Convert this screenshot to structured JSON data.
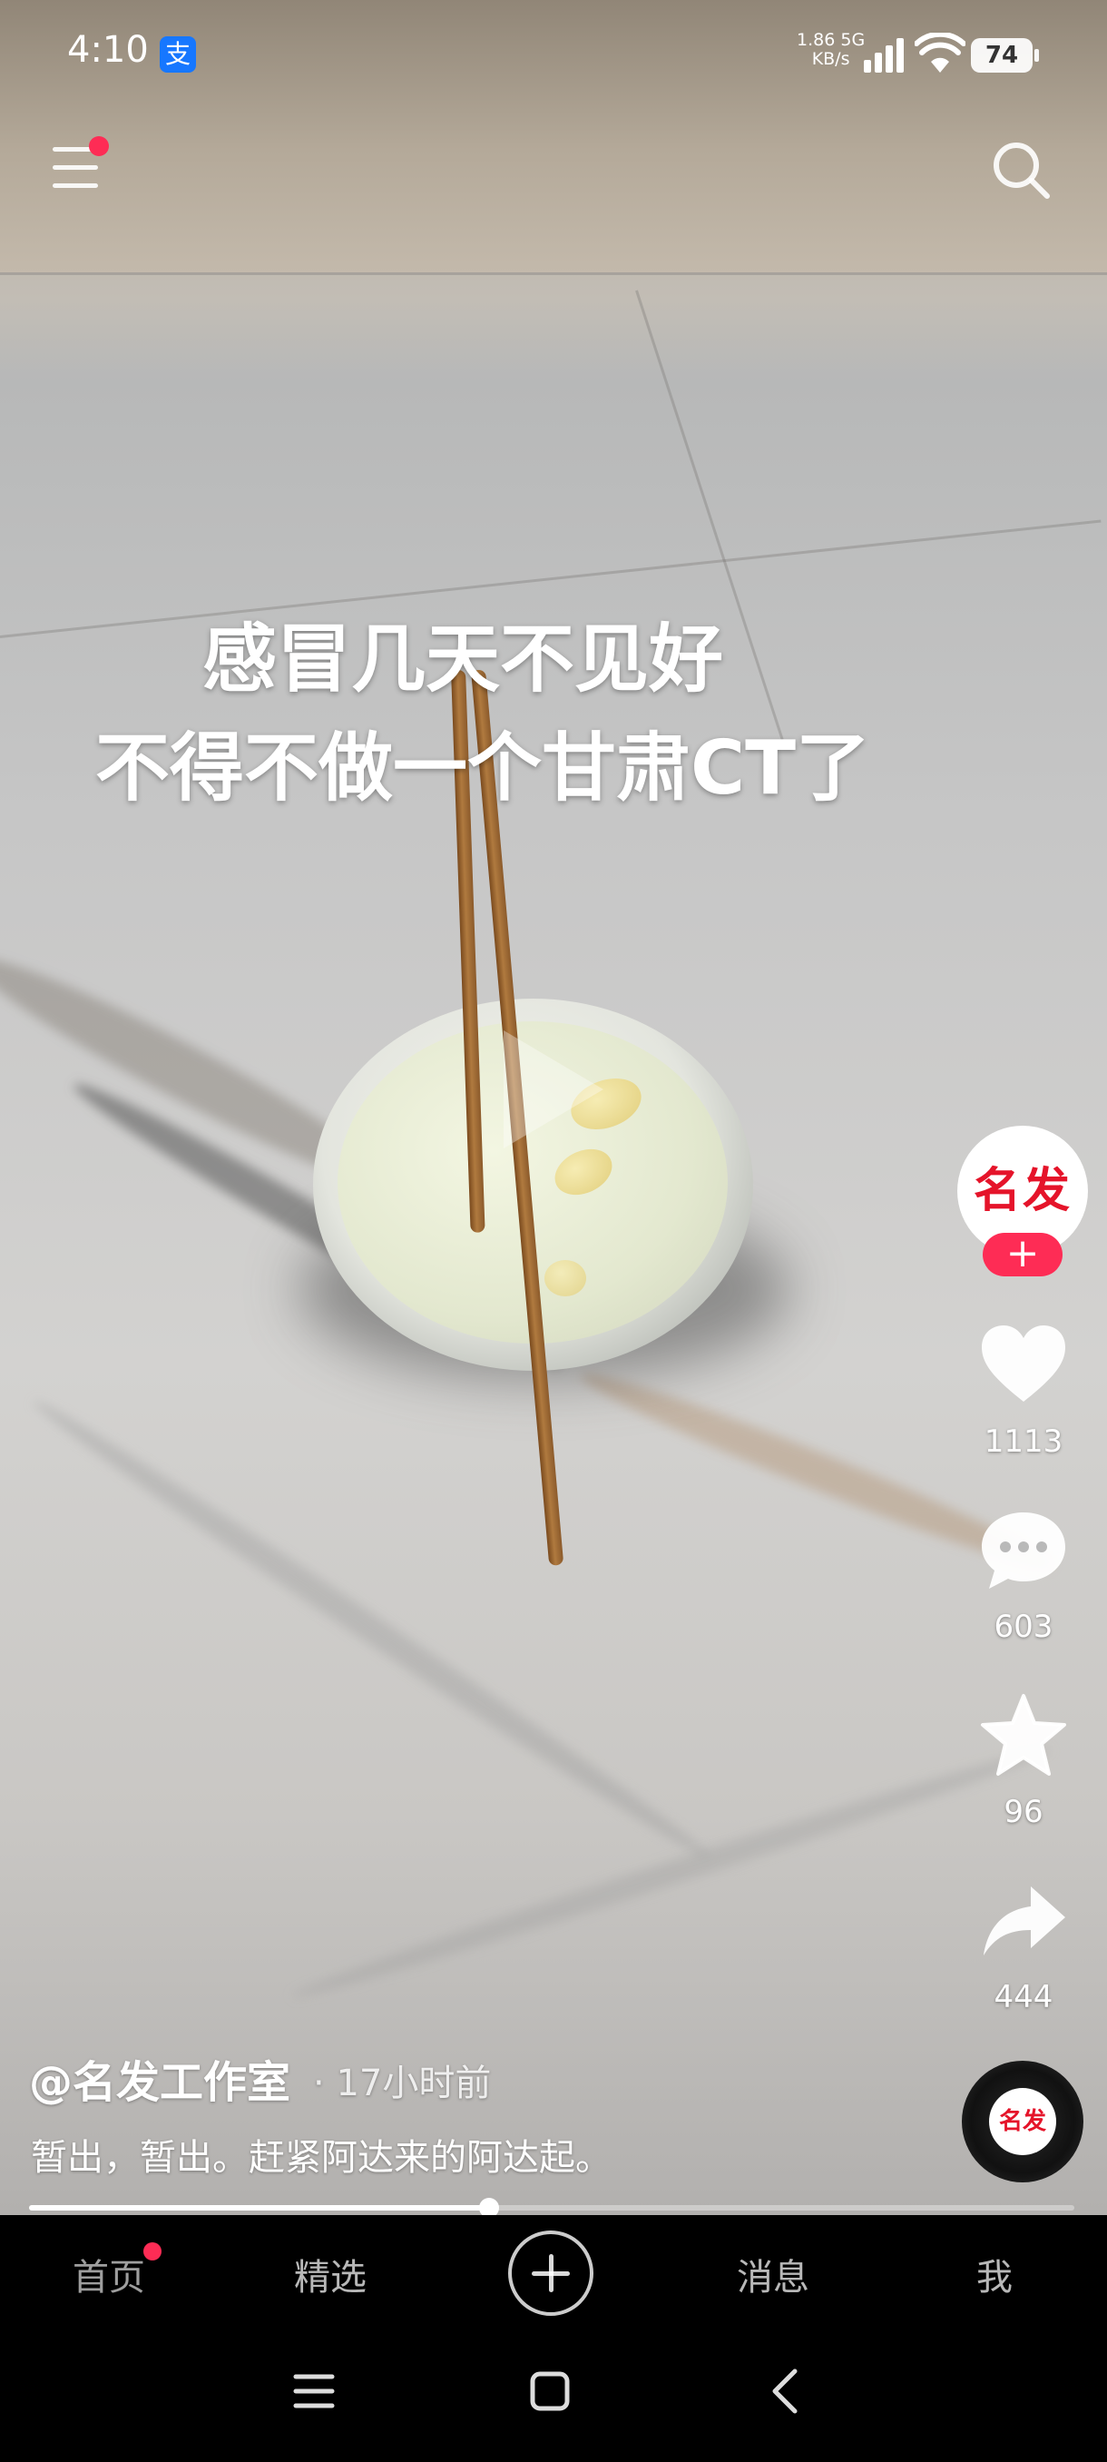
{
  "status_bar": {
    "time": "4:10",
    "app_badge": "支",
    "net_speed_value": "1.86",
    "net_speed_unit": "KB/s",
    "network": "5G",
    "battery": "74"
  },
  "video": {
    "overlay_line1": "感冒几天不见好",
    "overlay_line2": "不得不做一个甘肃CT了"
  },
  "author": {
    "name": "@名发工作室",
    "separator": "·",
    "time_ago": "17小时前",
    "avatar_text": "名发",
    "follow_symbol": "+"
  },
  "caption": "暂出，暂出。赶紧阿达来的阿达起。",
  "rail": {
    "likes": "1113",
    "comments": "603",
    "favorites": "96",
    "shares": "444",
    "disc_text": "名发"
  },
  "progress": {
    "fraction": 0.44
  },
  "bottom_nav": {
    "home": "首页",
    "featured": "精选",
    "messages": "消息",
    "me": "我"
  },
  "icons": [
    "menu-icon",
    "search-icon",
    "heart-icon",
    "comment-icon",
    "star-icon",
    "share-icon",
    "music-disc-icon",
    "plus-icon",
    "wifi-icon",
    "signal-icon",
    "battery-icon"
  ],
  "colors": {
    "accent": "#fe2c55",
    "brand_red": "#e5142a",
    "alipay_blue": "#1677ff"
  }
}
